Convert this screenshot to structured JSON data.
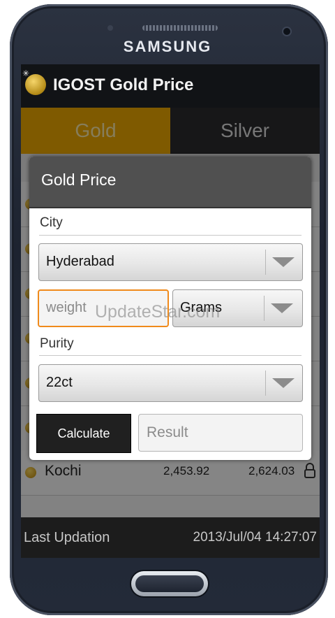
{
  "device": {
    "brand": "SAMSUNG"
  },
  "app": {
    "title": "IGOST Gold Price"
  },
  "tabs": [
    {
      "label": "Gold"
    },
    {
      "label": "Silver"
    }
  ],
  "list": {
    "rows": [
      {
        "city": "Kochi",
        "price_22ct": "2,453.92",
        "price_24ct": "2,624.03"
      }
    ]
  },
  "footer": {
    "label": "Last Updation",
    "timestamp": "2013/Jul/04 14:27:07"
  },
  "dialog": {
    "title": "Gold Price",
    "city_label": "City",
    "city_value": "Hyderabad",
    "weight_placeholder": "weight",
    "unit_value": "Grams",
    "purity_label": "Purity",
    "purity_value": "22ct",
    "calculate_label": "Calculate",
    "result_placeholder": "Result"
  },
  "watermark": "UpdateStar.com",
  "colors": {
    "gold_tab": "#e8a400",
    "silver_tab": "#2a2b2c",
    "focus": "#f08a1b"
  }
}
